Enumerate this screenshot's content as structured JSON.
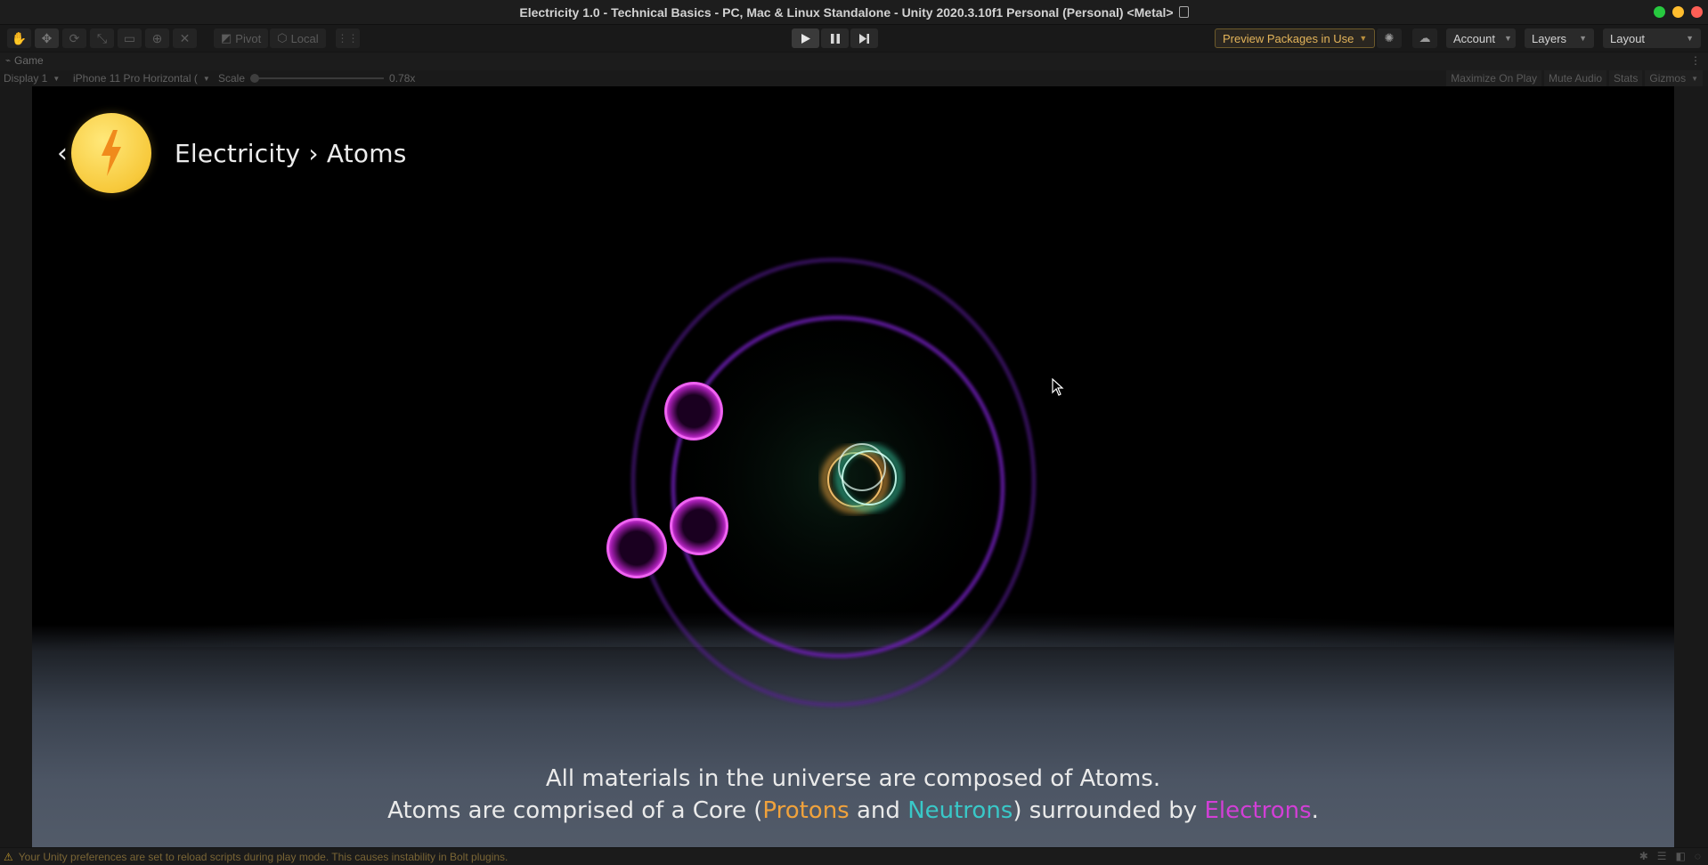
{
  "window": {
    "title": "Electricity 1.0 - Technical Basics - PC, Mac & Linux Standalone - Unity 2020.3.10f1 Personal (Personal) <Metal>",
    "traffic_colors": [
      "#27c93f",
      "#ffbd2e",
      "#ff5f56"
    ]
  },
  "toolbar": {
    "tools": [
      "hand-tool-icon",
      "move-tool-icon",
      "rotate-tool-icon",
      "scale-tool-icon",
      "rect-tool-icon",
      "transform-tool-icon",
      "custom-tool-icon"
    ],
    "pivot_label": "Pivot",
    "local_label": "Local",
    "preview_packages_label": "Preview Packages in Use",
    "account_label": "Account",
    "layers_label": "Layers",
    "layout_label": "Layout"
  },
  "game_tab": {
    "label": "Game"
  },
  "game_bar": {
    "display": "Display 1",
    "resolution": "iPhone 11 Pro Horizontal (",
    "scale_label": "Scale",
    "scale_value": "0.78x",
    "maximize_label": "Maximize On Play",
    "mute_label": "Mute Audio",
    "stats_label": "Stats",
    "gizmos_label": "Gizmos"
  },
  "scene": {
    "back_symbol": "‹",
    "breadcrumb": "Electricity › Atoms",
    "caption_line1": "All materials in the universe are composed of Atoms.",
    "caption_line2_a": "Atoms are comprised of a Core (",
    "protons": "Protons",
    "caption_and": " and ",
    "neutrons": "Neutrons",
    "caption_line2_b": ") surrounded by ",
    "electrons": "Electrons",
    "caption_end": ".",
    "colors": {
      "protons": "#f0a23c",
      "neutrons": "#39c8c8",
      "electrons": "#d23fd6",
      "orbit": "#6a1fb0",
      "badge": "#f7c93b"
    }
  },
  "status": {
    "message": "Your Unity preferences are set to reload scripts during play mode. This causes instability in Bolt plugins."
  }
}
